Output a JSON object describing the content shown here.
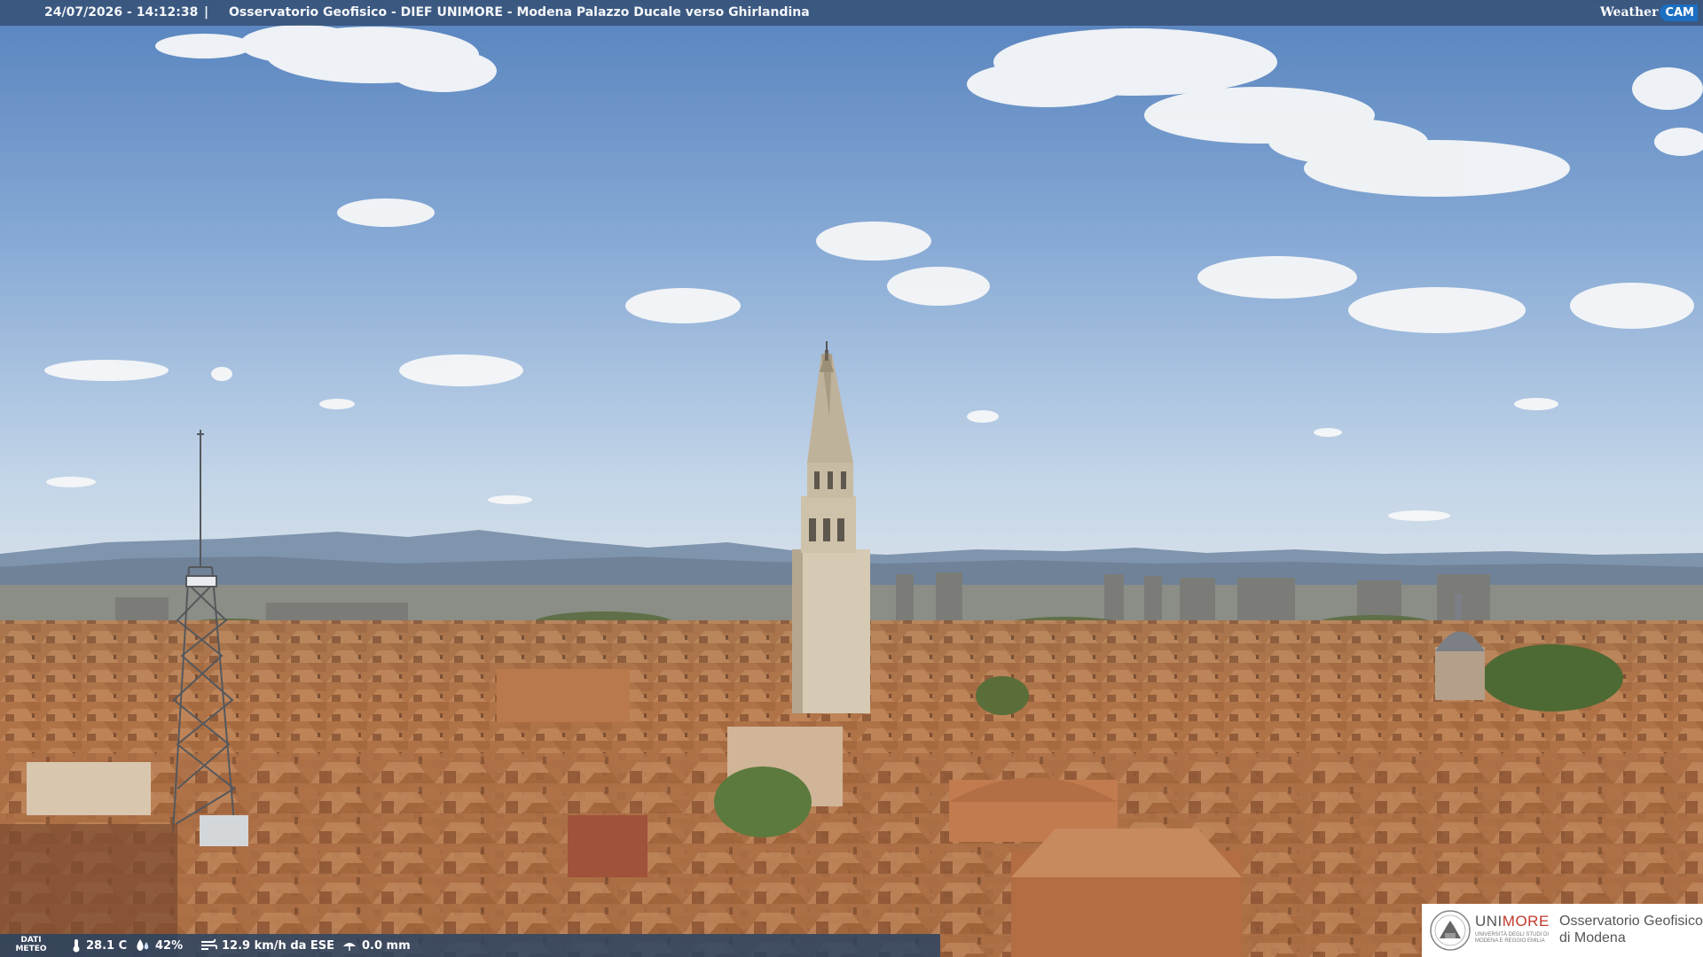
{
  "overlay": {
    "timestamp": "24/07/2026 - 14:12:38",
    "separator": "|",
    "caption": "Osservatorio Geofisico - DIEF UNIMORE - Modena Palazzo Ducale verso Ghirlandina",
    "brand_weather": "Weather",
    "brand_cam": "CAM"
  },
  "meteo": {
    "label_line1": "DATI",
    "label_line2": "METEO",
    "temperature": "28.1 C",
    "humidity": "42%",
    "wind": "12.9 km/h da ESE",
    "rain": "0.0 mm",
    "icons": [
      "thermometer-icon",
      "humidity-icon",
      "wind-icon",
      "rain-icon"
    ]
  },
  "logo": {
    "uni_prefix": "UNI",
    "uni_suffix": "MORE",
    "uni_sub": "UNIVERSITÀ DEGLI STUDI DI MODENA E REGGIO EMILIA",
    "obs_line1": "Osservatorio Geofisico",
    "obs_line2": "di Modena"
  },
  "colors": {
    "sky_top": "#5b86c0",
    "sky_horizon": "#c9d9ea",
    "roof": "#b5774a",
    "tower": "#cbbfa8",
    "bar": "#2f4a6c",
    "unimore_red": "#c0392b"
  }
}
